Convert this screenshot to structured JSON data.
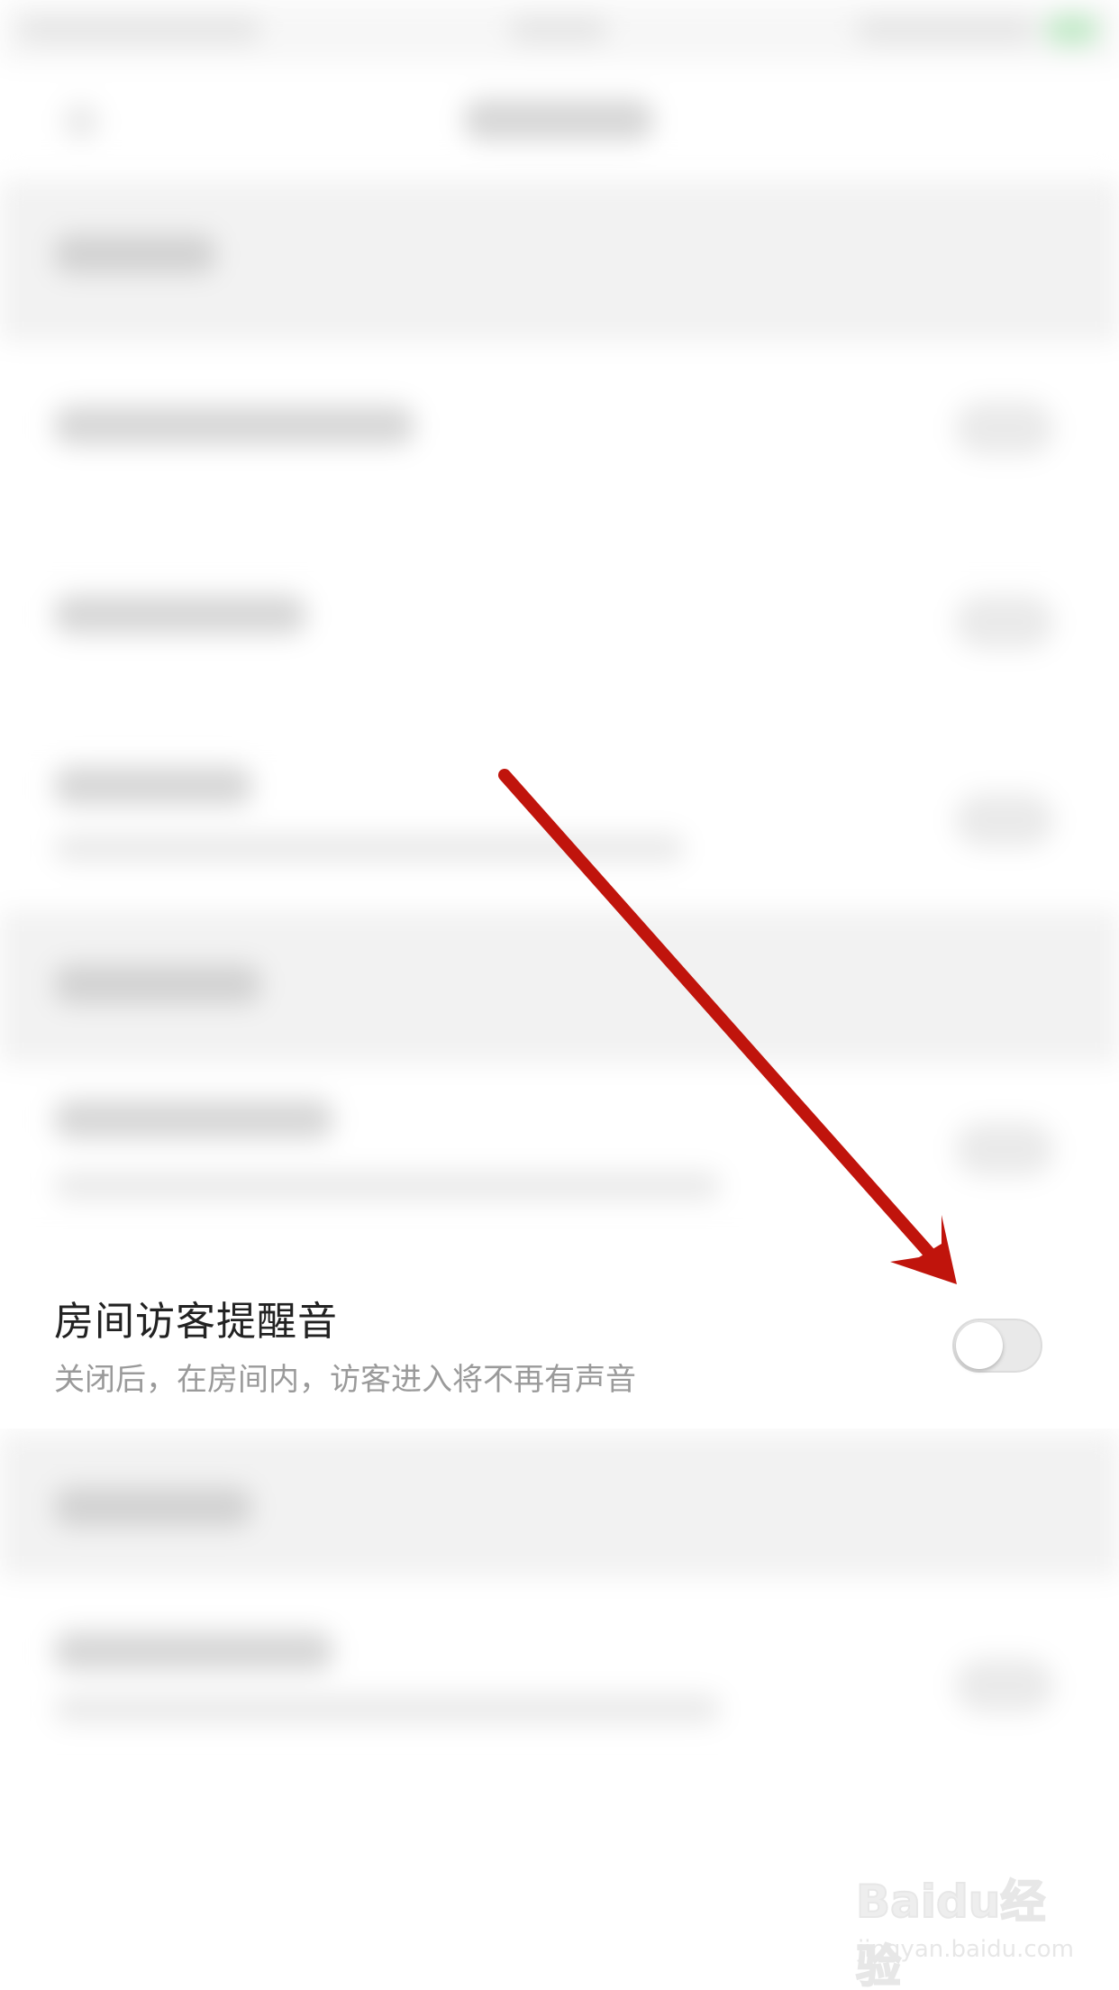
{
  "visitor_sound_row": {
    "title": "房间访客提醒音",
    "description": "关闭后，在房间内，访客进入将不再有声音",
    "toggle_on": false
  },
  "watermark": {
    "logo_text": "Baidu经验",
    "url_text": "jingyan.baidu.com"
  },
  "colors": {
    "annotation_arrow": "#c0140c",
    "title_text": "#222222",
    "subtitle_text": "#9a9a9a",
    "toggle_off_track": "#e9e9e9",
    "section_background": "#f2f2f2"
  },
  "icons": {
    "arrow": "arrow-annotation-icon",
    "back": "back-arrow-icon",
    "battery": "battery-icon"
  }
}
